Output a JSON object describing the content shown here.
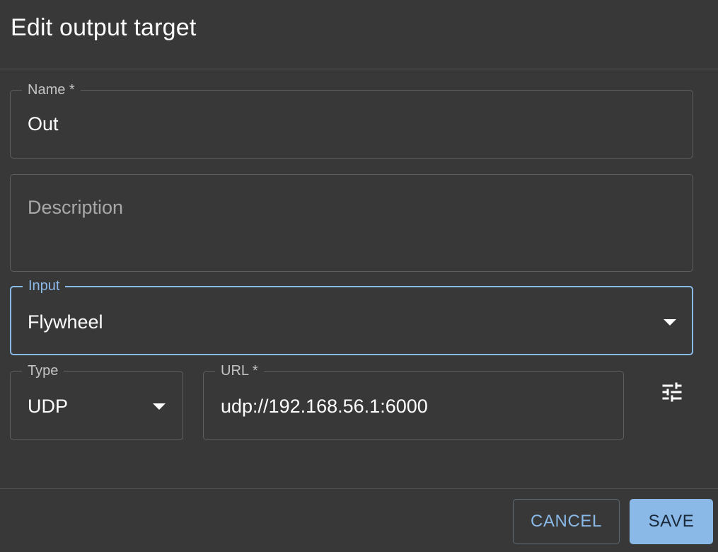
{
  "dialog": {
    "title": "Edit output target"
  },
  "fields": {
    "name": {
      "label": "Name *",
      "value": "Out"
    },
    "description": {
      "placeholder": "Description"
    },
    "input": {
      "label": "Input",
      "value": "Flywheel"
    },
    "type": {
      "label": "Type",
      "value": "UDP"
    },
    "url": {
      "label": "URL *",
      "value": "udp://192.168.56.1:6000"
    }
  },
  "actions": {
    "tune_icon": "tune-icon",
    "cancel_label": "CANCEL",
    "save_label": "SAVE"
  },
  "colors": {
    "background": "#383838",
    "accent": "#8ab9e8",
    "border": "#5f5f5f"
  }
}
